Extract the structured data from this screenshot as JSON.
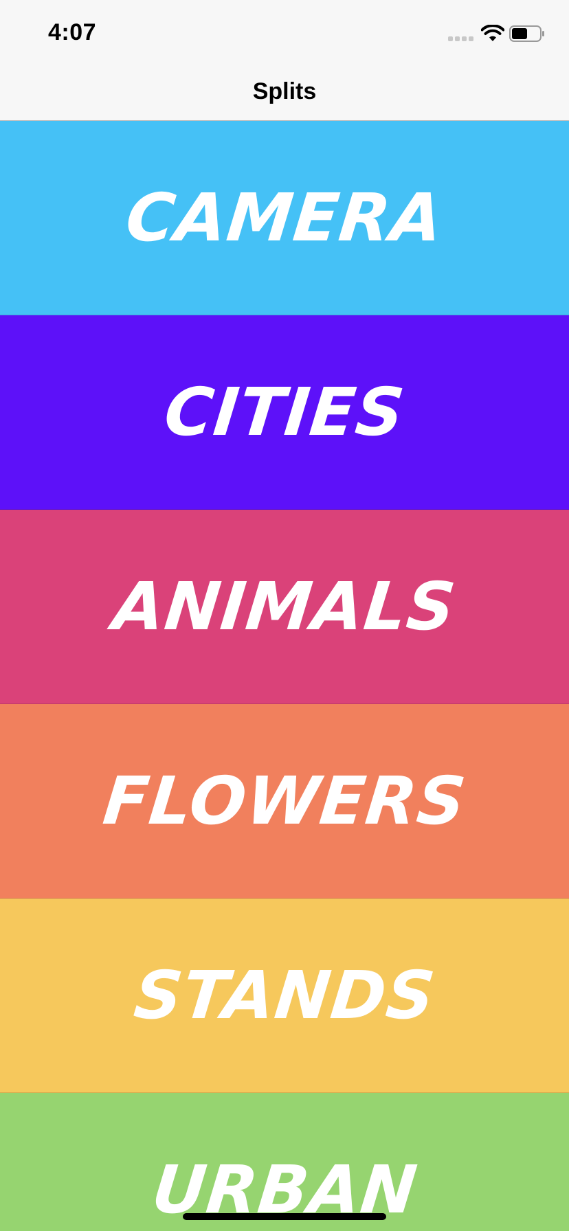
{
  "status_bar": {
    "time": "4:07",
    "icons": [
      "signal-icon",
      "wifi-icon",
      "battery-icon"
    ]
  },
  "nav": {
    "title": "Splits"
  },
  "categories": [
    {
      "label": "CAMERA",
      "color": "#45c1f6"
    },
    {
      "label": "CITIES",
      "color": "#5d11f9"
    },
    {
      "label": "ANIMALS",
      "color": "#da4279"
    },
    {
      "label": "FLOWERS",
      "color": "#f1805d"
    },
    {
      "label": "STANDS",
      "color": "#f6c85c"
    },
    {
      "label": "URBAN",
      "color": "#96d470"
    }
  ]
}
